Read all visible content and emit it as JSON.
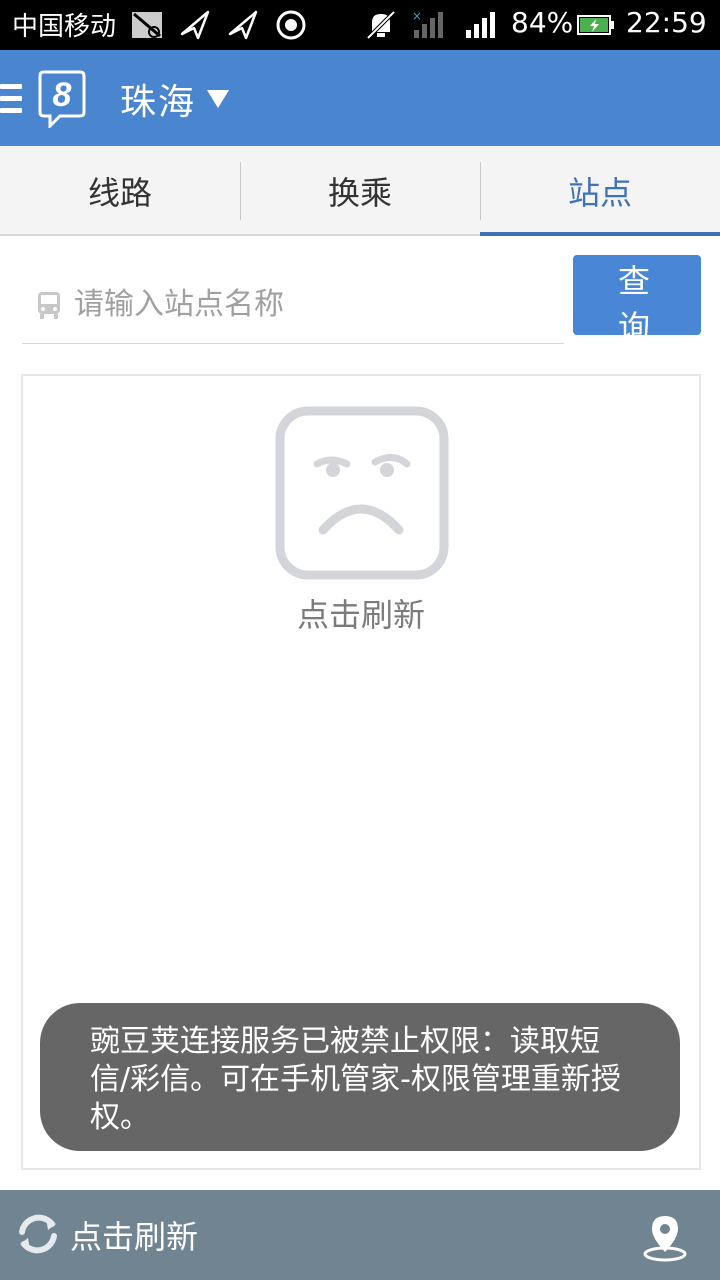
{
  "status_bar": {
    "carrier": "中国移动",
    "battery_percent": "84%",
    "time": "22:59",
    "icons": [
      "sim-blocked-icon",
      "send-icon",
      "send-icon",
      "record-icon",
      "mute-icon",
      "signal-icon",
      "signal-icon",
      "battery-charging-icon"
    ]
  },
  "header": {
    "city": "珠海",
    "logo": "8"
  },
  "tabs": [
    {
      "label": "线路",
      "active": false
    },
    {
      "label": "换乘",
      "active": false
    },
    {
      "label": "站点",
      "active": true
    }
  ],
  "search": {
    "placeholder": "请输入站点名称",
    "value": "",
    "button_label": "查询"
  },
  "empty_state": {
    "refresh_label": "点击刷新"
  },
  "toast": {
    "message": "豌豆荚连接服务已被禁止权限：读取短信/彩信。可在手机管家-权限管理重新授权。"
  },
  "bottom_bar": {
    "refresh_label": "点击刷新"
  },
  "colors": {
    "header": "#4a86cf",
    "accent": "#3f72b4",
    "button": "#4a86d6",
    "bottom_bar": "#708591",
    "toast": "#666666"
  }
}
